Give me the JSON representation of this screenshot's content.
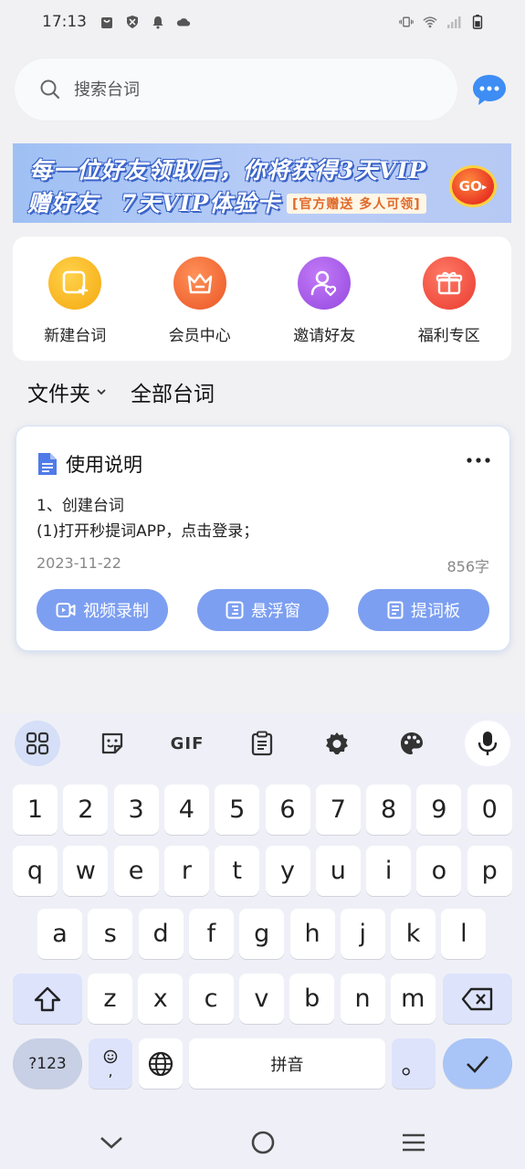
{
  "status": {
    "time": "17:13"
  },
  "search": {
    "placeholder": "搜索台词"
  },
  "banner": {
    "line1": "每一位好友领取后，你将获得3天VIP",
    "line2a": "赠好友",
    "line2b": "7天VIP体验卡",
    "tag": "[官方赠送 多人可领]",
    "go_label": "GO"
  },
  "actions": [
    {
      "label": "新建台词",
      "color": "#f8b51c"
    },
    {
      "label": "会员中心",
      "color": "#f06a32"
    },
    {
      "label": "邀请好友",
      "color": "#a154e6"
    },
    {
      "label": "福利专区",
      "color": "#f0493b"
    }
  ],
  "filters": {
    "folder": "文件夹",
    "all": "全部台词"
  },
  "document": {
    "title": "使用说明",
    "line1": "1、创建台词",
    "line2": "(1)打开秒提词APP，点击登录；",
    "date": "2023-11-22",
    "count": "856字",
    "buttons": [
      "视频录制",
      "悬浮窗",
      "提词板"
    ]
  },
  "keyboard": {
    "toolbar": [
      "apps-icon",
      "sticker-icon",
      "GIF",
      "clipboard-icon",
      "settings-icon",
      "palette-icon",
      "mic-icon"
    ],
    "row1": [
      "1",
      "2",
      "3",
      "4",
      "5",
      "6",
      "7",
      "8",
      "9",
      "0"
    ],
    "row2": [
      "q",
      "w",
      "e",
      "r",
      "t",
      "y",
      "u",
      "i",
      "o",
      "p"
    ],
    "row3": [
      "a",
      "s",
      "d",
      "f",
      "g",
      "h",
      "j",
      "k",
      "l"
    ],
    "row4": [
      "z",
      "x",
      "c",
      "v",
      "b",
      "n",
      "m"
    ],
    "sym_label": "?123",
    "emoji_comma": ",",
    "space_label": "拼音",
    "period": "。"
  },
  "colors": {
    "accent": "#7d9ff1",
    "doc_icon": "#4f7be8"
  }
}
